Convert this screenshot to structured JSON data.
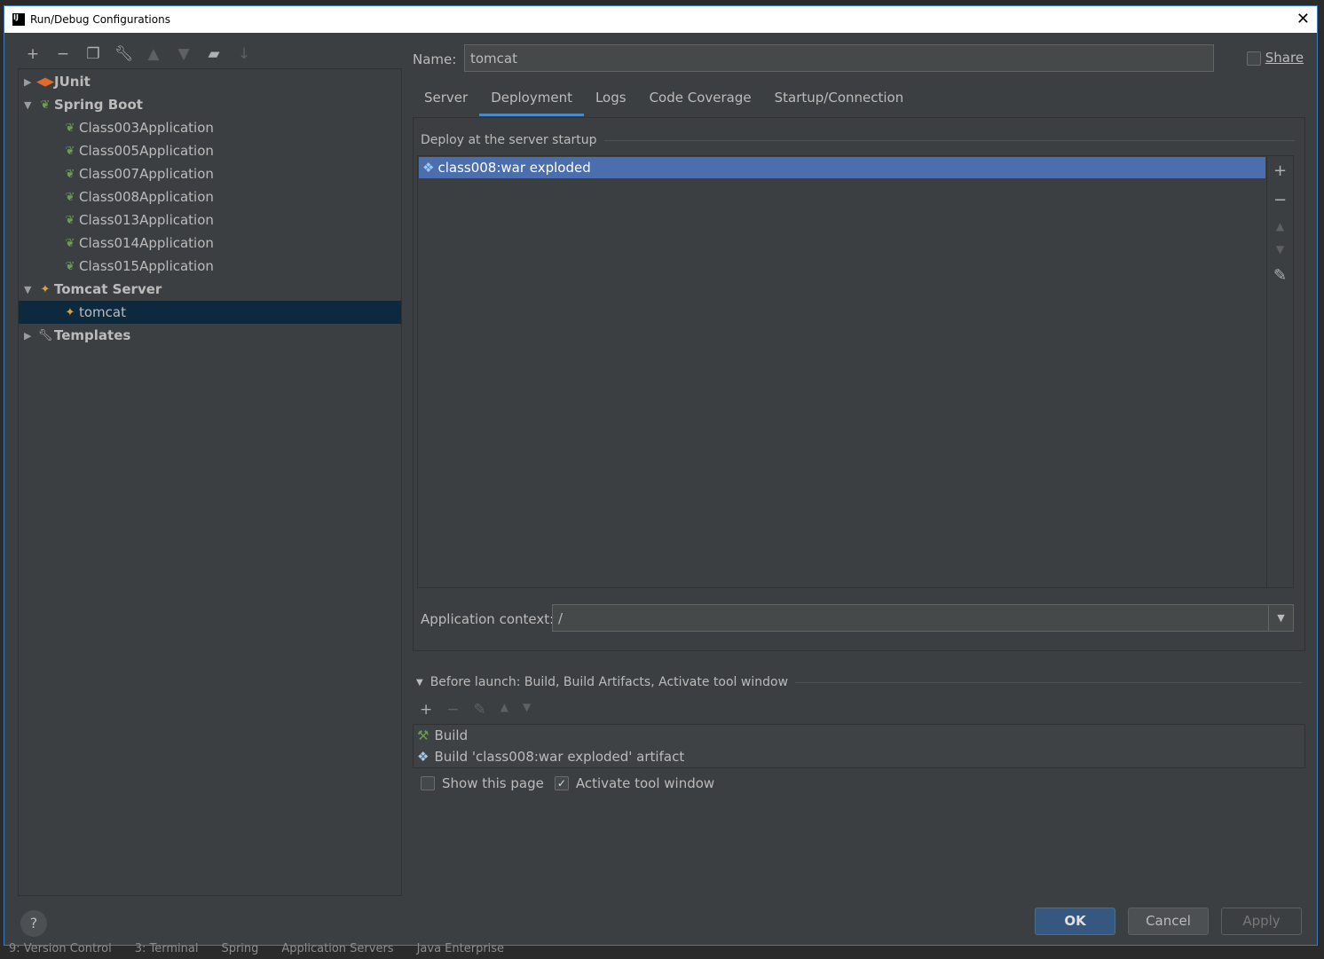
{
  "window": {
    "title": "Run/Debug Configurations",
    "logo": "IJ"
  },
  "toolbar": {
    "icons": [
      "add-icon",
      "remove-icon",
      "copy-icon",
      "wrench-icon",
      "move-up-icon",
      "move-down-icon",
      "folder-add-icon",
      "sort-icon"
    ]
  },
  "tree": {
    "junit": "JUnit",
    "spring_boot": "Spring Boot",
    "spring_items": [
      "Class003Application",
      "Class005Application",
      "Class007Application",
      "Class008Application",
      "Class013Application",
      "Class014Application",
      "Class015Application"
    ],
    "tomcat_server": "Tomcat Server",
    "tomcat": "tomcat",
    "templates": "Templates"
  },
  "name": {
    "label": "Name:",
    "value": "tomcat"
  },
  "share": {
    "label": "Share",
    "checked": false
  },
  "tabs": [
    "Server",
    "Deployment",
    "Logs",
    "Code Coverage",
    "Startup/Connection"
  ],
  "active_tab": "Deployment",
  "deploy": {
    "section": "Deploy at the server startup",
    "items": [
      "class008:war exploded"
    ]
  },
  "context": {
    "label": "Application context:",
    "value": "/"
  },
  "before_launch": {
    "title": "Before launch: Build, Build Artifacts, Activate tool window",
    "items": [
      "Build",
      "Build 'class008:war exploded' artifact"
    ]
  },
  "options": {
    "show_page": "Show this page",
    "show_page_checked": false,
    "activate": "Activate tool window",
    "activate_checked": true
  },
  "buttons": {
    "ok": "OK",
    "cancel": "Cancel",
    "apply": "Apply",
    "help": "?"
  },
  "statusbar": [
    "9: Version Control",
    "3: Terminal",
    "Spring",
    "Application Servers",
    "Java Enterprise"
  ],
  "colors": {
    "accent": "#4b6eaf",
    "selection": "#0d293e",
    "ok": "#365880"
  }
}
